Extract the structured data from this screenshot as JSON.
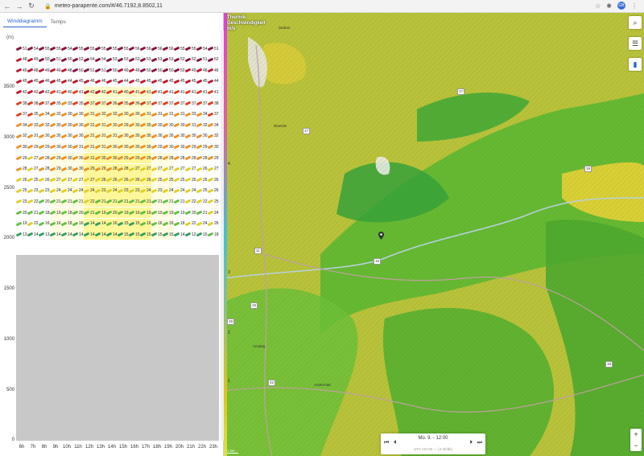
{
  "browser": {
    "url": "meteo-parapente.com/#/46.7192,8.8502,11",
    "avatar_initials": "GB"
  },
  "tabs": [
    {
      "label": "Winddiagramm",
      "active": true
    },
    {
      "label": "Temps",
      "active": false
    }
  ],
  "wind_panel": {
    "unit_label": "(m)",
    "y_labels": [
      "3500",
      "3000",
      "2500",
      "2000",
      "1500",
      "1000",
      "500",
      "0"
    ],
    "hours": [
      "6h",
      "7h",
      "8h",
      "9h",
      "10h",
      "11h",
      "12h",
      "13h",
      "14h",
      "15h",
      "16h",
      "17h",
      "18h",
      "19h",
      "20h",
      "21h",
      "22h",
      "23h"
    ],
    "rows": [
      [
        "51",
        "54",
        "55",
        "55",
        "54",
        "55",
        "55",
        "55",
        "55",
        "55",
        "56",
        "56",
        "56",
        "56",
        "55",
        "55",
        "54",
        "51"
      ],
      [
        "48",
        "49",
        "50",
        "51",
        "50",
        "52",
        "54",
        "54",
        "53",
        "53",
        "53",
        "53",
        "53",
        "53",
        "52",
        "52",
        "51",
        "52"
      ],
      [
        "49",
        "48",
        "49",
        "49",
        "48",
        "50",
        "51",
        "51",
        "50",
        "49",
        "49",
        "50",
        "50",
        "50",
        "50",
        "49",
        "48",
        "46"
      ],
      [
        "45",
        "45",
        "46",
        "45",
        "44",
        "45",
        "46",
        "46",
        "45",
        "44",
        "45",
        "45",
        "45",
        "45",
        "45",
        "45",
        "45",
        "44"
      ],
      [
        "42",
        "42",
        "42",
        "41",
        "40",
        "41",
        "42",
        "42",
        "41",
        "40",
        "41",
        "41",
        "41",
        "41",
        "41",
        "41",
        "41",
        "41"
      ],
      [
        "38",
        "38",
        "37",
        "35",
        "33",
        "35",
        "37",
        "37",
        "36",
        "35",
        "36",
        "37",
        "37",
        "37",
        "37",
        "37",
        "37",
        "38"
      ],
      [
        "37",
        "35",
        "34",
        "32",
        "30",
        "30",
        "31",
        "32",
        "32",
        "30",
        "30",
        "31",
        "31",
        "31",
        "31",
        "33",
        "34",
        "37"
      ],
      [
        "34",
        "33",
        "32",
        "30",
        "30",
        "30",
        "31",
        "31",
        "30",
        "29",
        "30",
        "30",
        "30",
        "30",
        "30",
        "31",
        "32",
        "34"
      ],
      [
        "32",
        "31",
        "30",
        "30",
        "30",
        "30",
        "31",
        "31",
        "31",
        "30",
        "30",
        "30",
        "30",
        "30",
        "30",
        "30",
        "30",
        "32"
      ],
      [
        "30",
        "29",
        "29",
        "30",
        "30",
        "31",
        "31",
        "31",
        "30",
        "30",
        "30",
        "30",
        "29",
        "30",
        "30",
        "29",
        "29",
        "30"
      ],
      [
        "29",
        "27",
        "28",
        "29",
        "30",
        "30",
        "31",
        "30",
        "30",
        "29",
        "29",
        "29",
        "28",
        "28",
        "28",
        "28",
        "28",
        "29"
      ],
      [
        "28",
        "27",
        "28",
        "29",
        "30",
        "30",
        "29",
        "29",
        "28",
        "28",
        "27",
        "27",
        "27",
        "27",
        "27",
        "27",
        "26",
        "27"
      ],
      [
        "26",
        "25",
        "26",
        "27",
        "27",
        "27",
        "27",
        "26",
        "26",
        "26",
        "26",
        "26",
        "25",
        "25",
        "25",
        "25",
        "25",
        "26"
      ],
      [
        "25",
        "23",
        "23",
        "24",
        "24",
        "24",
        "24",
        "23",
        "24",
        "23",
        "23",
        "24",
        "23",
        "24",
        "24",
        "24",
        "25",
        "26"
      ],
      [
        "23",
        "22",
        "20",
        "21",
        "21",
        "21",
        "22",
        "21",
        "21",
        "21",
        "21",
        "21",
        "21",
        "21",
        "21",
        "22",
        "22",
        "25"
      ],
      [
        "20",
        "21",
        "18",
        "19",
        "18",
        "20",
        "21",
        "19",
        "20",
        "19",
        "19",
        "19",
        "19",
        "19",
        "19",
        "20",
        "21",
        "24"
      ],
      [
        "19",
        "22",
        "16",
        "16",
        "18",
        "16",
        "14",
        "14",
        "16",
        "15",
        "15",
        "16",
        "16",
        "16",
        "18",
        "22",
        "24",
        "26"
      ],
      [
        "13",
        "14",
        "13",
        "14",
        "14",
        "14",
        "14",
        "14",
        "14",
        "15",
        "15",
        "15",
        "15",
        "15",
        "14",
        "12",
        "15",
        "18"
      ]
    ]
  },
  "map": {
    "title_line1": "Thermik",
    "title_line2": "Geschwindigkeit",
    "title_line3": "m/s",
    "legend_ticks": [
      "4",
      "3",
      "2",
      "1"
    ],
    "road_badges": [
      "17",
      "17",
      "19",
      "11",
      "16",
      "19",
      "19",
      "42",
      "19",
      "17"
    ],
    "towns": [
      "Sedrun",
      "Disentis",
      "Amsteg",
      "Andermatt"
    ],
    "scale_label": "1 km",
    "timebar": {
      "date": "Mo. 9. - 12:00",
      "sub": "UTC+02:00 — (3.3b/dk)"
    }
  },
  "colors": {
    "accent": "#2a64c8",
    "thermal_low": "#c8c040",
    "thermal_mid": "#7dc030",
    "thermal_high": "#40b040"
  }
}
